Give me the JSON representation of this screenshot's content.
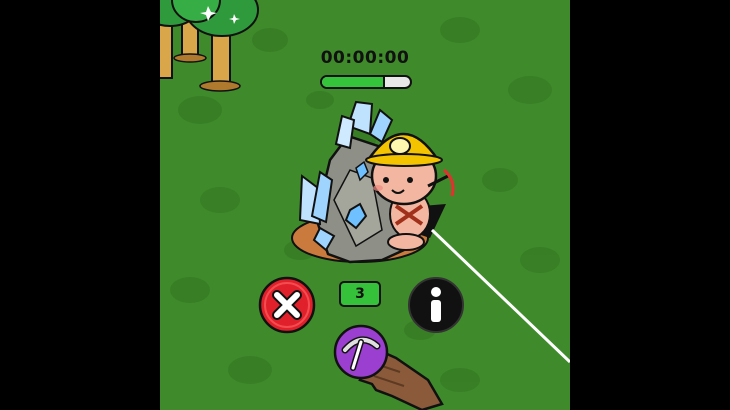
{
  "hud": {
    "timer": "00:00:00",
    "progress_fraction": 0.72
  },
  "actions": {
    "count": "3",
    "close_icon": "x-icon",
    "info_icon": "info-icon",
    "tool_icon": "pickaxe-icon"
  },
  "colors": {
    "grass": "#3f8a2a",
    "progress": "#34c33a",
    "close_button": "#e0202a",
    "info_button": "#111111",
    "tool_button": "#9b3fd0",
    "helmet": "#f5c400"
  }
}
